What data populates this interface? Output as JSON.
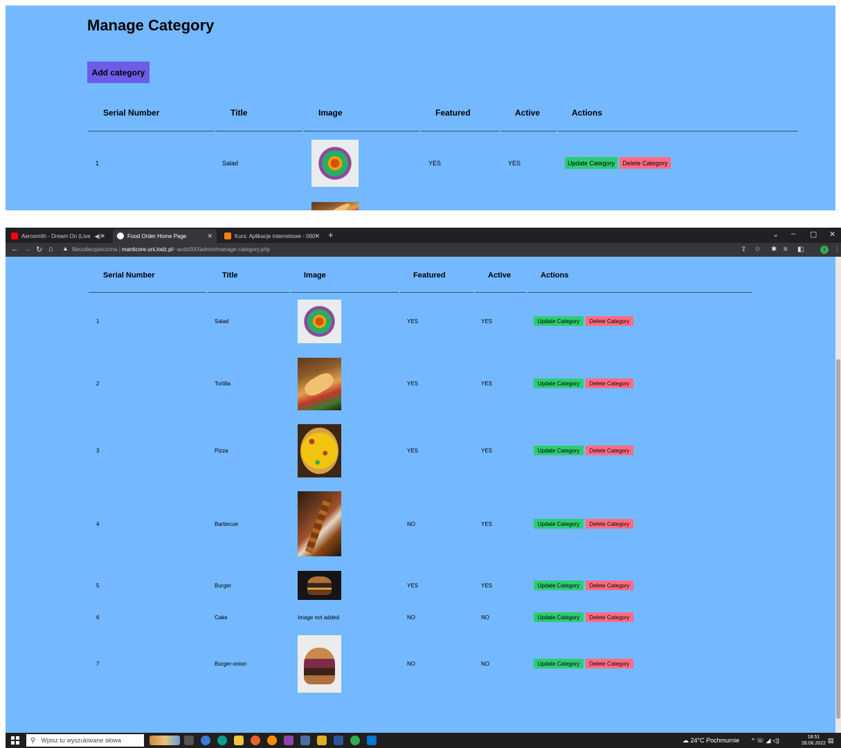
{
  "page": {
    "title": "Manage Category",
    "add_button": "Add category",
    "headers": {
      "serial": "Serial Number",
      "title": "Title",
      "image": "Image",
      "featured": "Featured",
      "active": "Active",
      "actions": "Actions"
    },
    "update_label": "Update Category",
    "delete_label": "Delete Category",
    "rows": [
      {
        "serial": "1",
        "title": "Salad",
        "image": "salad",
        "image_text": "",
        "featured": "YES",
        "active": "YES"
      },
      {
        "serial": "2",
        "title": "Tortilla",
        "image": "tortilla",
        "image_text": "",
        "featured": "YES",
        "active": "YES"
      },
      {
        "serial": "3",
        "title": "Pizza",
        "image": "pizza",
        "image_text": "",
        "featured": "YES",
        "active": "YES"
      },
      {
        "serial": "4",
        "title": "Barbecue",
        "image": "bbq",
        "image_text": "",
        "featured": "NO",
        "active": "YES"
      },
      {
        "serial": "5",
        "title": "Burger",
        "image": "burger",
        "image_text": "",
        "featured": "YES",
        "active": "YES"
      },
      {
        "serial": "6",
        "title": "Cake",
        "image": "",
        "image_text": "Image not added",
        "featured": "NO",
        "active": "NO"
      },
      {
        "serial": "7",
        "title": "Burger-onion",
        "image": "burger-onion",
        "image_text": "",
        "featured": "NO",
        "active": "NO"
      }
    ]
  },
  "browser": {
    "tabs": [
      {
        "label": "Aerosmith - Dream On (Live",
        "icon": "youtube-icon"
      },
      {
        "label": "Food Order Home Page",
        "icon": "globe-icon"
      },
      {
        "label": "Kurs: Aplikacje internetowe - 060",
        "icon": "moodle-icon"
      }
    ],
    "url_warning": "Niezabezpieczona",
    "url_host": "manticore.uni.lodz.pl",
    "url_path": "/~acdc000/admin/manage-category.php",
    "profile_initial": "I"
  },
  "taskbar": {
    "search_placeholder": "Wpisz tu wyszukiwane słowa",
    "weather": "24°C Pochmurnie",
    "time": "18:51",
    "date": "28.06.2022"
  },
  "colors": {
    "page_bg": "#74b9ff",
    "add_button": "#6c5ce7",
    "update_button": "#2ecc71",
    "delete_button": "#ff6b81"
  }
}
